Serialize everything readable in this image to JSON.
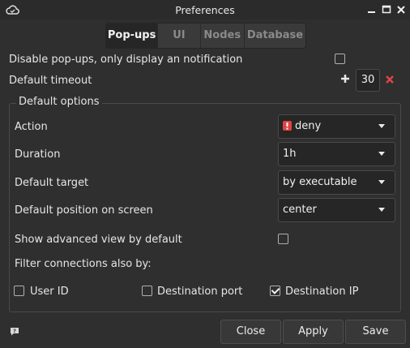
{
  "window": {
    "title": "Preferences",
    "app_icon": "cloud-icon",
    "controls": [
      "minimize-icon",
      "maximize-icon",
      "close-icon"
    ]
  },
  "tabs": [
    {
      "label": "Pop-ups",
      "active": true
    },
    {
      "label": "UI",
      "active": false
    },
    {
      "label": "Nodes",
      "active": false
    },
    {
      "label": "Database",
      "active": false
    }
  ],
  "popups": {
    "disable_label": "Disable pop-ups, only display an notification",
    "disable_checked": false,
    "timeout_label": "Default timeout",
    "timeout_value": "30"
  },
  "default_options": {
    "title": "Default options",
    "action_label": "Action",
    "action_value": "deny",
    "duration_label": "Duration",
    "duration_value": "1h",
    "target_label": "Default target",
    "target_value": "by executable",
    "position_label": "Default position on screen",
    "position_value": "center",
    "advanced_label": "Show advanced view by default",
    "advanced_checked": false,
    "filter_label": "Filter connections also by:",
    "filters": [
      {
        "label": "User ID",
        "checked": false
      },
      {
        "label": "Destination port",
        "checked": false
      },
      {
        "label": "Destination IP",
        "checked": true
      }
    ]
  },
  "buttons": {
    "close": "Close",
    "apply": "Apply",
    "save": "Save"
  },
  "colors": {
    "background": "#2f2f2f",
    "field": "#262626",
    "deny_icon": "#e04343",
    "remove_icon": "#e04343"
  }
}
